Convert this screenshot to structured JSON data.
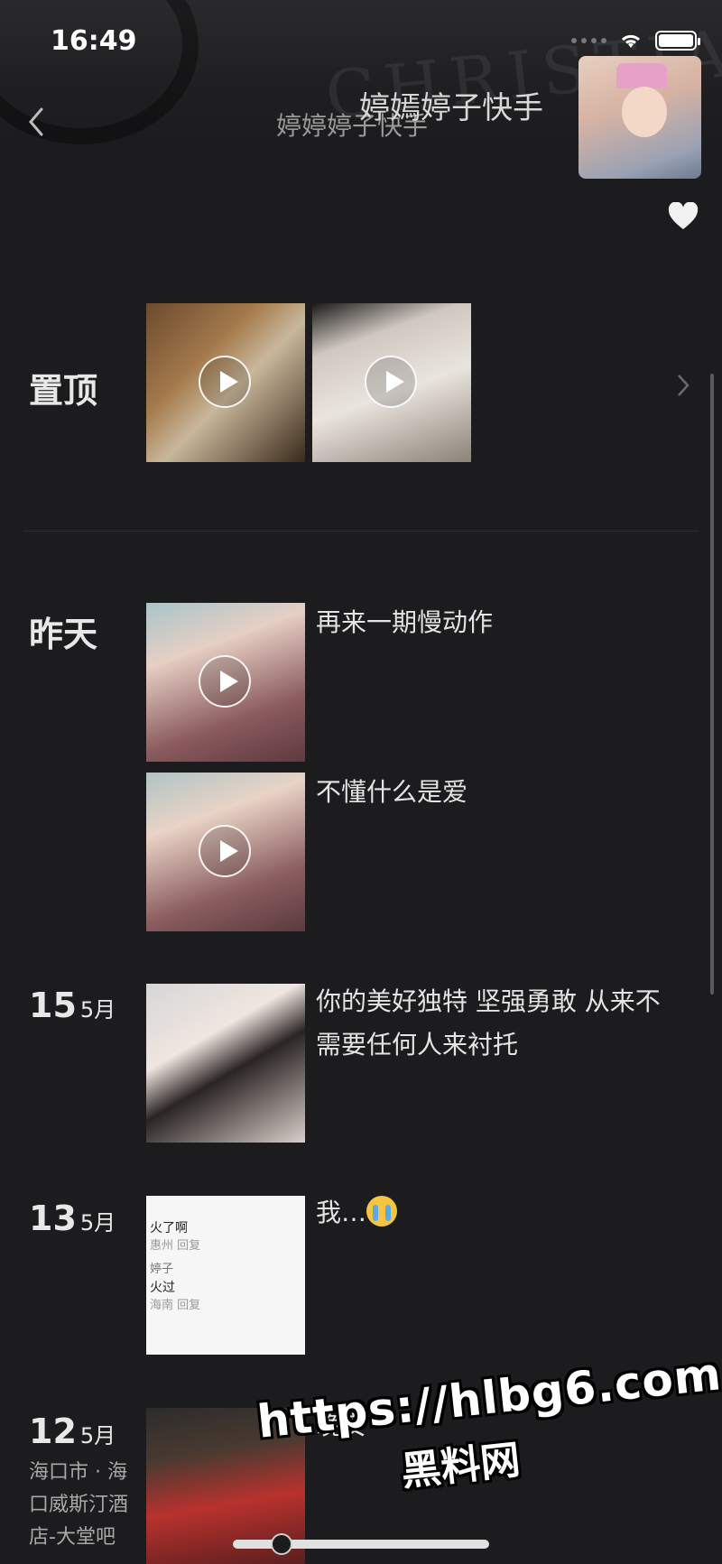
{
  "status_bar": {
    "time": "16:49"
  },
  "header": {
    "title_main": "婷嫣婷子快手",
    "title_sub": "婷婷婷子快手",
    "bg_text": "CHRISTIA"
  },
  "sections": {
    "pinned": {
      "label": "置顶"
    },
    "yesterday": {
      "label": "昨天",
      "posts": [
        {
          "caption": "再来一期慢动作"
        },
        {
          "caption": "不懂什么是爱"
        }
      ]
    },
    "may15": {
      "day": "15",
      "month": "5月",
      "caption": "你的美好独特 坚强勇敢 从来不需要任何人来衬托"
    },
    "may13": {
      "day": "13",
      "month": "5月",
      "caption": "我…",
      "preview_lines": [
        "火了啊",
        "惠州  回复",
        "婷子",
        "火过",
        "海南  回复"
      ]
    },
    "may12": {
      "day": "12",
      "month": "5月",
      "location": "海口市 · 海口威斯汀酒店-大堂吧",
      "caption": "晚安"
    }
  },
  "watermark": {
    "url": "https://hlbg6.com",
    "site": "黑料网"
  },
  "colors": {
    "background": "#1c1c1e",
    "text": "#e4e4e4",
    "muted": "#a8a8a8"
  }
}
